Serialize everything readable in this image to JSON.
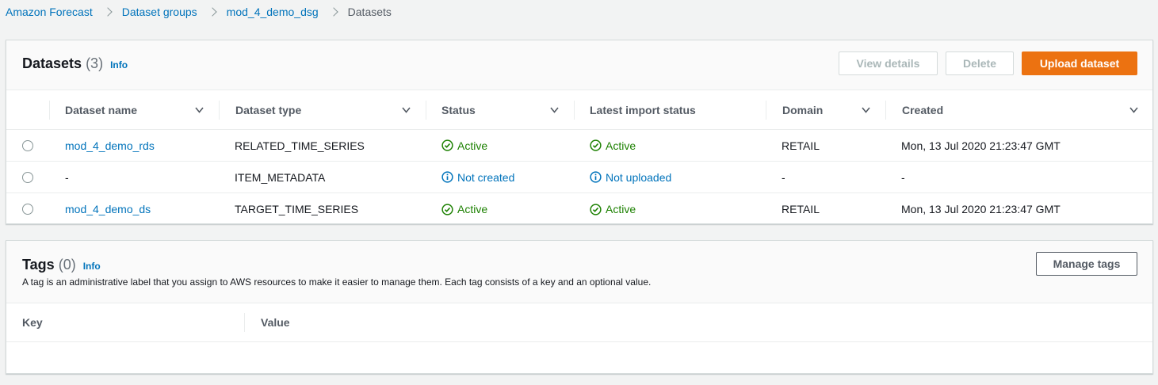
{
  "breadcrumb": {
    "items": [
      "Amazon Forecast",
      "Dataset groups",
      "mod_4_demo_dsg"
    ],
    "current": "Datasets"
  },
  "datasets": {
    "title": "Datasets",
    "count": "(3)",
    "info": "Info",
    "buttons": {
      "view_details": "View details",
      "delete": "Delete",
      "upload": "Upload dataset"
    },
    "columns": [
      "Dataset name",
      "Dataset type",
      "Status",
      "Latest import status",
      "Domain",
      "Created"
    ],
    "rows": [
      {
        "name": "mod_4_demo_rds",
        "type": "RELATED_TIME_SERIES",
        "status": "Active",
        "status_kind": "success",
        "import_status": "Active",
        "import_kind": "success",
        "domain": "RETAIL",
        "created": "Mon, 13 Jul 2020 21:23:47 GMT"
      },
      {
        "name": "-",
        "type": "ITEM_METADATA",
        "status": "Not created",
        "status_kind": "info",
        "import_status": "Not uploaded",
        "import_kind": "info",
        "domain": "-",
        "created": "-"
      },
      {
        "name": "mod_4_demo_ds",
        "type": "TARGET_TIME_SERIES",
        "status": "Active",
        "status_kind": "success",
        "import_status": "Active",
        "import_kind": "success",
        "domain": "RETAIL",
        "created": "Mon, 13 Jul 2020 21:23:47 GMT"
      }
    ]
  },
  "tags": {
    "title": "Tags",
    "count": "(0)",
    "info": "Info",
    "description": "A tag is an administrative label that you assign to AWS resources to make it easier to manage them. Each tag consists of a key and an optional value.",
    "manage_button": "Manage tags",
    "columns": [
      "Key",
      "Value"
    ]
  },
  "colors": {
    "link": "#0073bb",
    "primary": "#ec7211",
    "success": "#1d8102",
    "background": "#f2f3f3"
  },
  "icons": {
    "breadcrumb_separator": "chevron-right-icon",
    "sort": "caret-down-icon",
    "success": "status-success-icon",
    "info": "status-info-icon"
  }
}
